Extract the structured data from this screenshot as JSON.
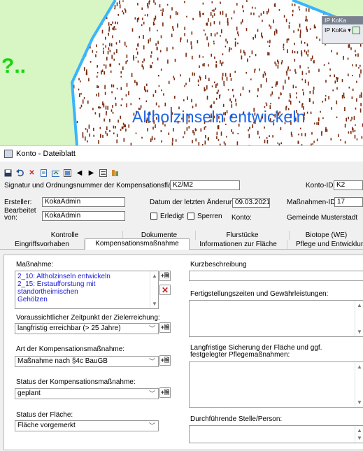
{
  "map": {
    "area_label": "Altholzinseln entwickeln",
    "partial_text": "?..",
    "layer_panel_title": "IP KoKa",
    "layer_select": "IP KoKa ▾"
  },
  "window": {
    "title": "Konto - Dateiblatt",
    "toolbar_icons": [
      "save-icon",
      "undo-icon",
      "delete-icon",
      "document-icon",
      "export-icon",
      "layers-icon",
      "previous-icon",
      "next-icon",
      "list-icon",
      "settings-icon"
    ],
    "signature_label": "Signatur und Ordnungsnummer der Kompensationsfläche:",
    "signature_value": "K2/M2",
    "konto_id_label": "Konto-ID:",
    "konto_id_value": "K2",
    "ersteller_label": "Ersteller:",
    "ersteller_value": "KokaAdmin",
    "datum_label": "Datum der letzten Änderung:",
    "datum_value": "09.03.2021",
    "massnahmen_id_label": "Maßnahmen-ID:",
    "massnahmen_id_value": "17",
    "bearbeitet_label_1": "Bearbeitet",
    "bearbeitet_label_2": "von:",
    "bearbeitet_value": "KokaAdmin",
    "erledigt_label": "Erledigt",
    "sperren_label": "Sperren",
    "konto_label": "Konto:",
    "konto_value": "Gemeinde Musterstadt"
  },
  "tabs_row1": [
    "Kontrolle",
    "Dokumente",
    "Flurstücke",
    "Biotope (WE)"
  ],
  "tabs_row2": [
    "Eingriffsvorhaben",
    "Kompensationsmaßnahme",
    "Informationen zur Fläche",
    "Pflege und Entwicklun"
  ],
  "panel": {
    "massnahme_label": "Maßnahme:",
    "massnahme_items": [
      "2_10: Altholzinseln entwickeln",
      "2_15: Erstaufforstung mit standortheimischen",
      "Gehölzen"
    ],
    "zeitpunkt_label": "Voraussichtlicher Zeitpunkt der Zielerreichung:",
    "zeitpunkt_value": "langfristig erreichbar (> 25 Jahre)",
    "art_label": "Art der Kompensationsmaßnahme:",
    "art_value": "Maßnahme nach §4c BauGB",
    "status_label": "Status der Kompensationsmaßnahme:",
    "status_value": "geplant",
    "flaeche_label": "Status der Fläche:",
    "flaeche_value": "Fläche vorgemerkt",
    "kurz_label": "Kurzbeschreibung",
    "fertig_label": "Fertigstellungszeiten und Gewährleistungen:",
    "lang_label_1": "Langfristige Sicherung der Fläche und ggf.",
    "lang_label_2": "festgelegter Pflegemaßnahmen:",
    "durch_label": "Durchführende Stelle/Person:"
  },
  "colors": {
    "map_green": "#d7f6c4",
    "polygon_stroke": "#3ab4ff",
    "dots": "#7a2a10",
    "label_blue": "#1e64e6",
    "list_blue": "#1a1ad8"
  }
}
